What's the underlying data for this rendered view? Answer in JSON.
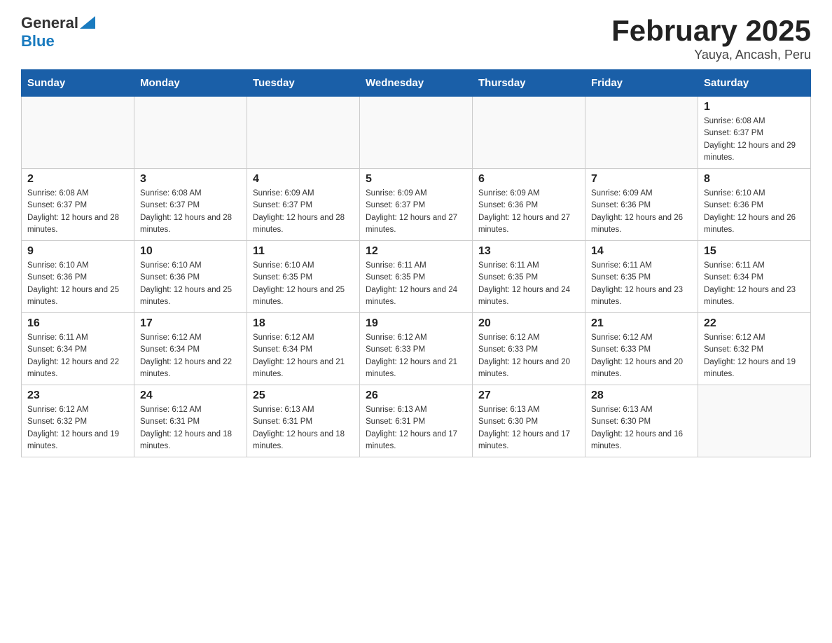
{
  "header": {
    "logo": {
      "general": "General",
      "blue": "Blue"
    },
    "title": "February 2025",
    "location": "Yauya, Ancash, Peru"
  },
  "weekdays": [
    "Sunday",
    "Monday",
    "Tuesday",
    "Wednesday",
    "Thursday",
    "Friday",
    "Saturday"
  ],
  "weeks": [
    [
      {
        "day": "",
        "info": ""
      },
      {
        "day": "",
        "info": ""
      },
      {
        "day": "",
        "info": ""
      },
      {
        "day": "",
        "info": ""
      },
      {
        "day": "",
        "info": ""
      },
      {
        "day": "",
        "info": ""
      },
      {
        "day": "1",
        "info": "Sunrise: 6:08 AM\nSunset: 6:37 PM\nDaylight: 12 hours and 29 minutes."
      }
    ],
    [
      {
        "day": "2",
        "info": "Sunrise: 6:08 AM\nSunset: 6:37 PM\nDaylight: 12 hours and 28 minutes."
      },
      {
        "day": "3",
        "info": "Sunrise: 6:08 AM\nSunset: 6:37 PM\nDaylight: 12 hours and 28 minutes."
      },
      {
        "day": "4",
        "info": "Sunrise: 6:09 AM\nSunset: 6:37 PM\nDaylight: 12 hours and 28 minutes."
      },
      {
        "day": "5",
        "info": "Sunrise: 6:09 AM\nSunset: 6:37 PM\nDaylight: 12 hours and 27 minutes."
      },
      {
        "day": "6",
        "info": "Sunrise: 6:09 AM\nSunset: 6:36 PM\nDaylight: 12 hours and 27 minutes."
      },
      {
        "day": "7",
        "info": "Sunrise: 6:09 AM\nSunset: 6:36 PM\nDaylight: 12 hours and 26 minutes."
      },
      {
        "day": "8",
        "info": "Sunrise: 6:10 AM\nSunset: 6:36 PM\nDaylight: 12 hours and 26 minutes."
      }
    ],
    [
      {
        "day": "9",
        "info": "Sunrise: 6:10 AM\nSunset: 6:36 PM\nDaylight: 12 hours and 25 minutes."
      },
      {
        "day": "10",
        "info": "Sunrise: 6:10 AM\nSunset: 6:36 PM\nDaylight: 12 hours and 25 minutes."
      },
      {
        "day": "11",
        "info": "Sunrise: 6:10 AM\nSunset: 6:35 PM\nDaylight: 12 hours and 25 minutes."
      },
      {
        "day": "12",
        "info": "Sunrise: 6:11 AM\nSunset: 6:35 PM\nDaylight: 12 hours and 24 minutes."
      },
      {
        "day": "13",
        "info": "Sunrise: 6:11 AM\nSunset: 6:35 PM\nDaylight: 12 hours and 24 minutes."
      },
      {
        "day": "14",
        "info": "Sunrise: 6:11 AM\nSunset: 6:35 PM\nDaylight: 12 hours and 23 minutes."
      },
      {
        "day": "15",
        "info": "Sunrise: 6:11 AM\nSunset: 6:34 PM\nDaylight: 12 hours and 23 minutes."
      }
    ],
    [
      {
        "day": "16",
        "info": "Sunrise: 6:11 AM\nSunset: 6:34 PM\nDaylight: 12 hours and 22 minutes."
      },
      {
        "day": "17",
        "info": "Sunrise: 6:12 AM\nSunset: 6:34 PM\nDaylight: 12 hours and 22 minutes."
      },
      {
        "day": "18",
        "info": "Sunrise: 6:12 AM\nSunset: 6:34 PM\nDaylight: 12 hours and 21 minutes."
      },
      {
        "day": "19",
        "info": "Sunrise: 6:12 AM\nSunset: 6:33 PM\nDaylight: 12 hours and 21 minutes."
      },
      {
        "day": "20",
        "info": "Sunrise: 6:12 AM\nSunset: 6:33 PM\nDaylight: 12 hours and 20 minutes."
      },
      {
        "day": "21",
        "info": "Sunrise: 6:12 AM\nSunset: 6:33 PM\nDaylight: 12 hours and 20 minutes."
      },
      {
        "day": "22",
        "info": "Sunrise: 6:12 AM\nSunset: 6:32 PM\nDaylight: 12 hours and 19 minutes."
      }
    ],
    [
      {
        "day": "23",
        "info": "Sunrise: 6:12 AM\nSunset: 6:32 PM\nDaylight: 12 hours and 19 minutes."
      },
      {
        "day": "24",
        "info": "Sunrise: 6:12 AM\nSunset: 6:31 PM\nDaylight: 12 hours and 18 minutes."
      },
      {
        "day": "25",
        "info": "Sunrise: 6:13 AM\nSunset: 6:31 PM\nDaylight: 12 hours and 18 minutes."
      },
      {
        "day": "26",
        "info": "Sunrise: 6:13 AM\nSunset: 6:31 PM\nDaylight: 12 hours and 17 minutes."
      },
      {
        "day": "27",
        "info": "Sunrise: 6:13 AM\nSunset: 6:30 PM\nDaylight: 12 hours and 17 minutes."
      },
      {
        "day": "28",
        "info": "Sunrise: 6:13 AM\nSunset: 6:30 PM\nDaylight: 12 hours and 16 minutes."
      },
      {
        "day": "",
        "info": ""
      }
    ]
  ]
}
